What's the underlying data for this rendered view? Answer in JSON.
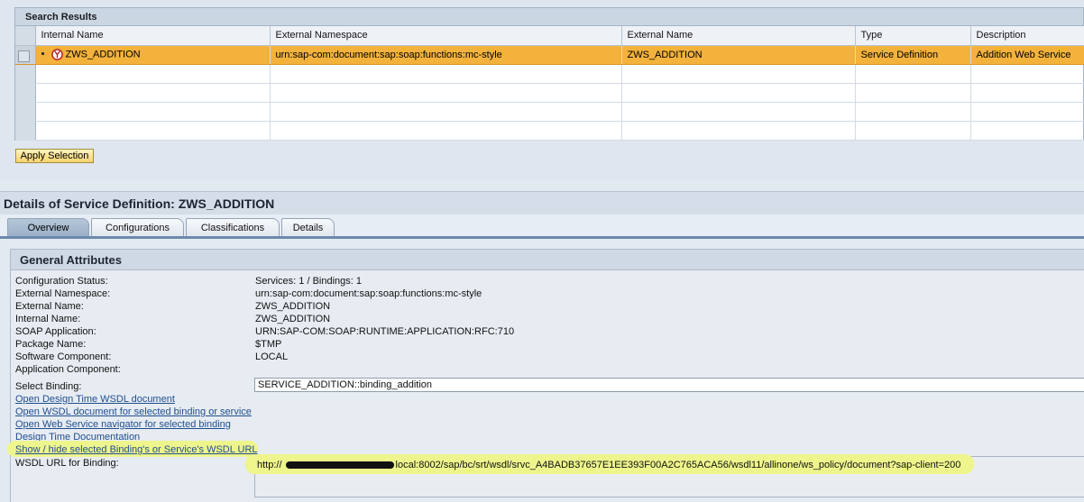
{
  "search_results": {
    "title": "Search Results",
    "columns": [
      "Internal Name",
      "External Namespace",
      "External Name",
      "Type",
      "Description"
    ],
    "rows": [
      {
        "internal_name": "ZWS_ADDITION",
        "external_namespace": "urn:sap-com:document:sap:soap:functions:mc-style",
        "external_name": "ZWS_ADDITION",
        "type": "Service Definition",
        "description": "Addition Web Service",
        "selected": true
      }
    ],
    "apply_label": "Apply Selection"
  },
  "details": {
    "title": "Details of Service Definition: ZWS_ADDITION",
    "tabs": [
      "Overview",
      "Configurations",
      "Classifications",
      "Details"
    ],
    "active_tab": "Overview",
    "section_title": "General Attributes",
    "attributes": [
      {
        "label": "Configuration Status:",
        "value": "Services: 1 / Bindings: 1"
      },
      {
        "label": "External Namespace:",
        "value": "urn:sap-com:document:sap:soap:functions:mc-style"
      },
      {
        "label": "External Name:",
        "value": "ZWS_ADDITION"
      },
      {
        "label": "Internal Name:",
        "value": "ZWS_ADDITION"
      },
      {
        "label": "SOAP Application:",
        "value": "URN:SAP-COM:SOAP:RUNTIME:APPLICATION:RFC:710"
      },
      {
        "label": "Package Name:",
        "value": "$TMP"
      },
      {
        "label": "Software Component:",
        "value": "LOCAL"
      },
      {
        "label": "Application Component:",
        "value": ""
      }
    ],
    "select_binding_label": "Select Binding:",
    "select_binding_value": "SERVICE_ADDITION::binding_addition",
    "links": [
      "Open Design Time WSDL document",
      "Open WSDL document for selected binding or service",
      "Open Web Service navigator for selected binding",
      "Design Time Documentation",
      "Show / hide selected Binding's or Service's WSDL URL"
    ],
    "wsdl_label": "WSDL URL for Binding:",
    "wsdl_url_prefix": "http://",
    "wsdl_url_suffix": "local:8002/sap/bc/srt/wsdl/srvc_A4BADB37657E1EE393F00A2C765ACA56/wsdl11/allinone/ws_policy/document?sap-client=200"
  },
  "colors": {
    "selected_row": "#f2b23c",
    "highlight": "#eef58c",
    "link": "#1f4e8f"
  }
}
